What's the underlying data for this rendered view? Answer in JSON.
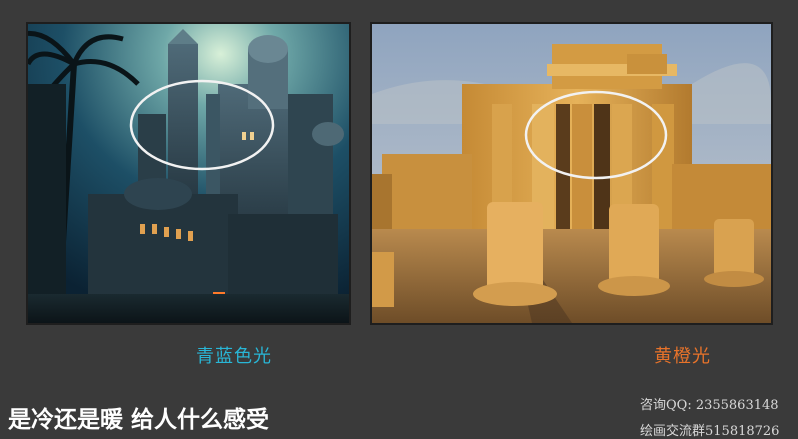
{
  "images": {
    "left": {
      "caption": "青蓝色光",
      "caption_color": "#29b6d6"
    },
    "right": {
      "caption": "黄橙光",
      "caption_color": "#e8732a"
    }
  },
  "question": "是冷还是暖 给人什么感受",
  "contact": {
    "qq": "咨询QQ: 2355863148",
    "group": "绘画交流群515818726"
  }
}
